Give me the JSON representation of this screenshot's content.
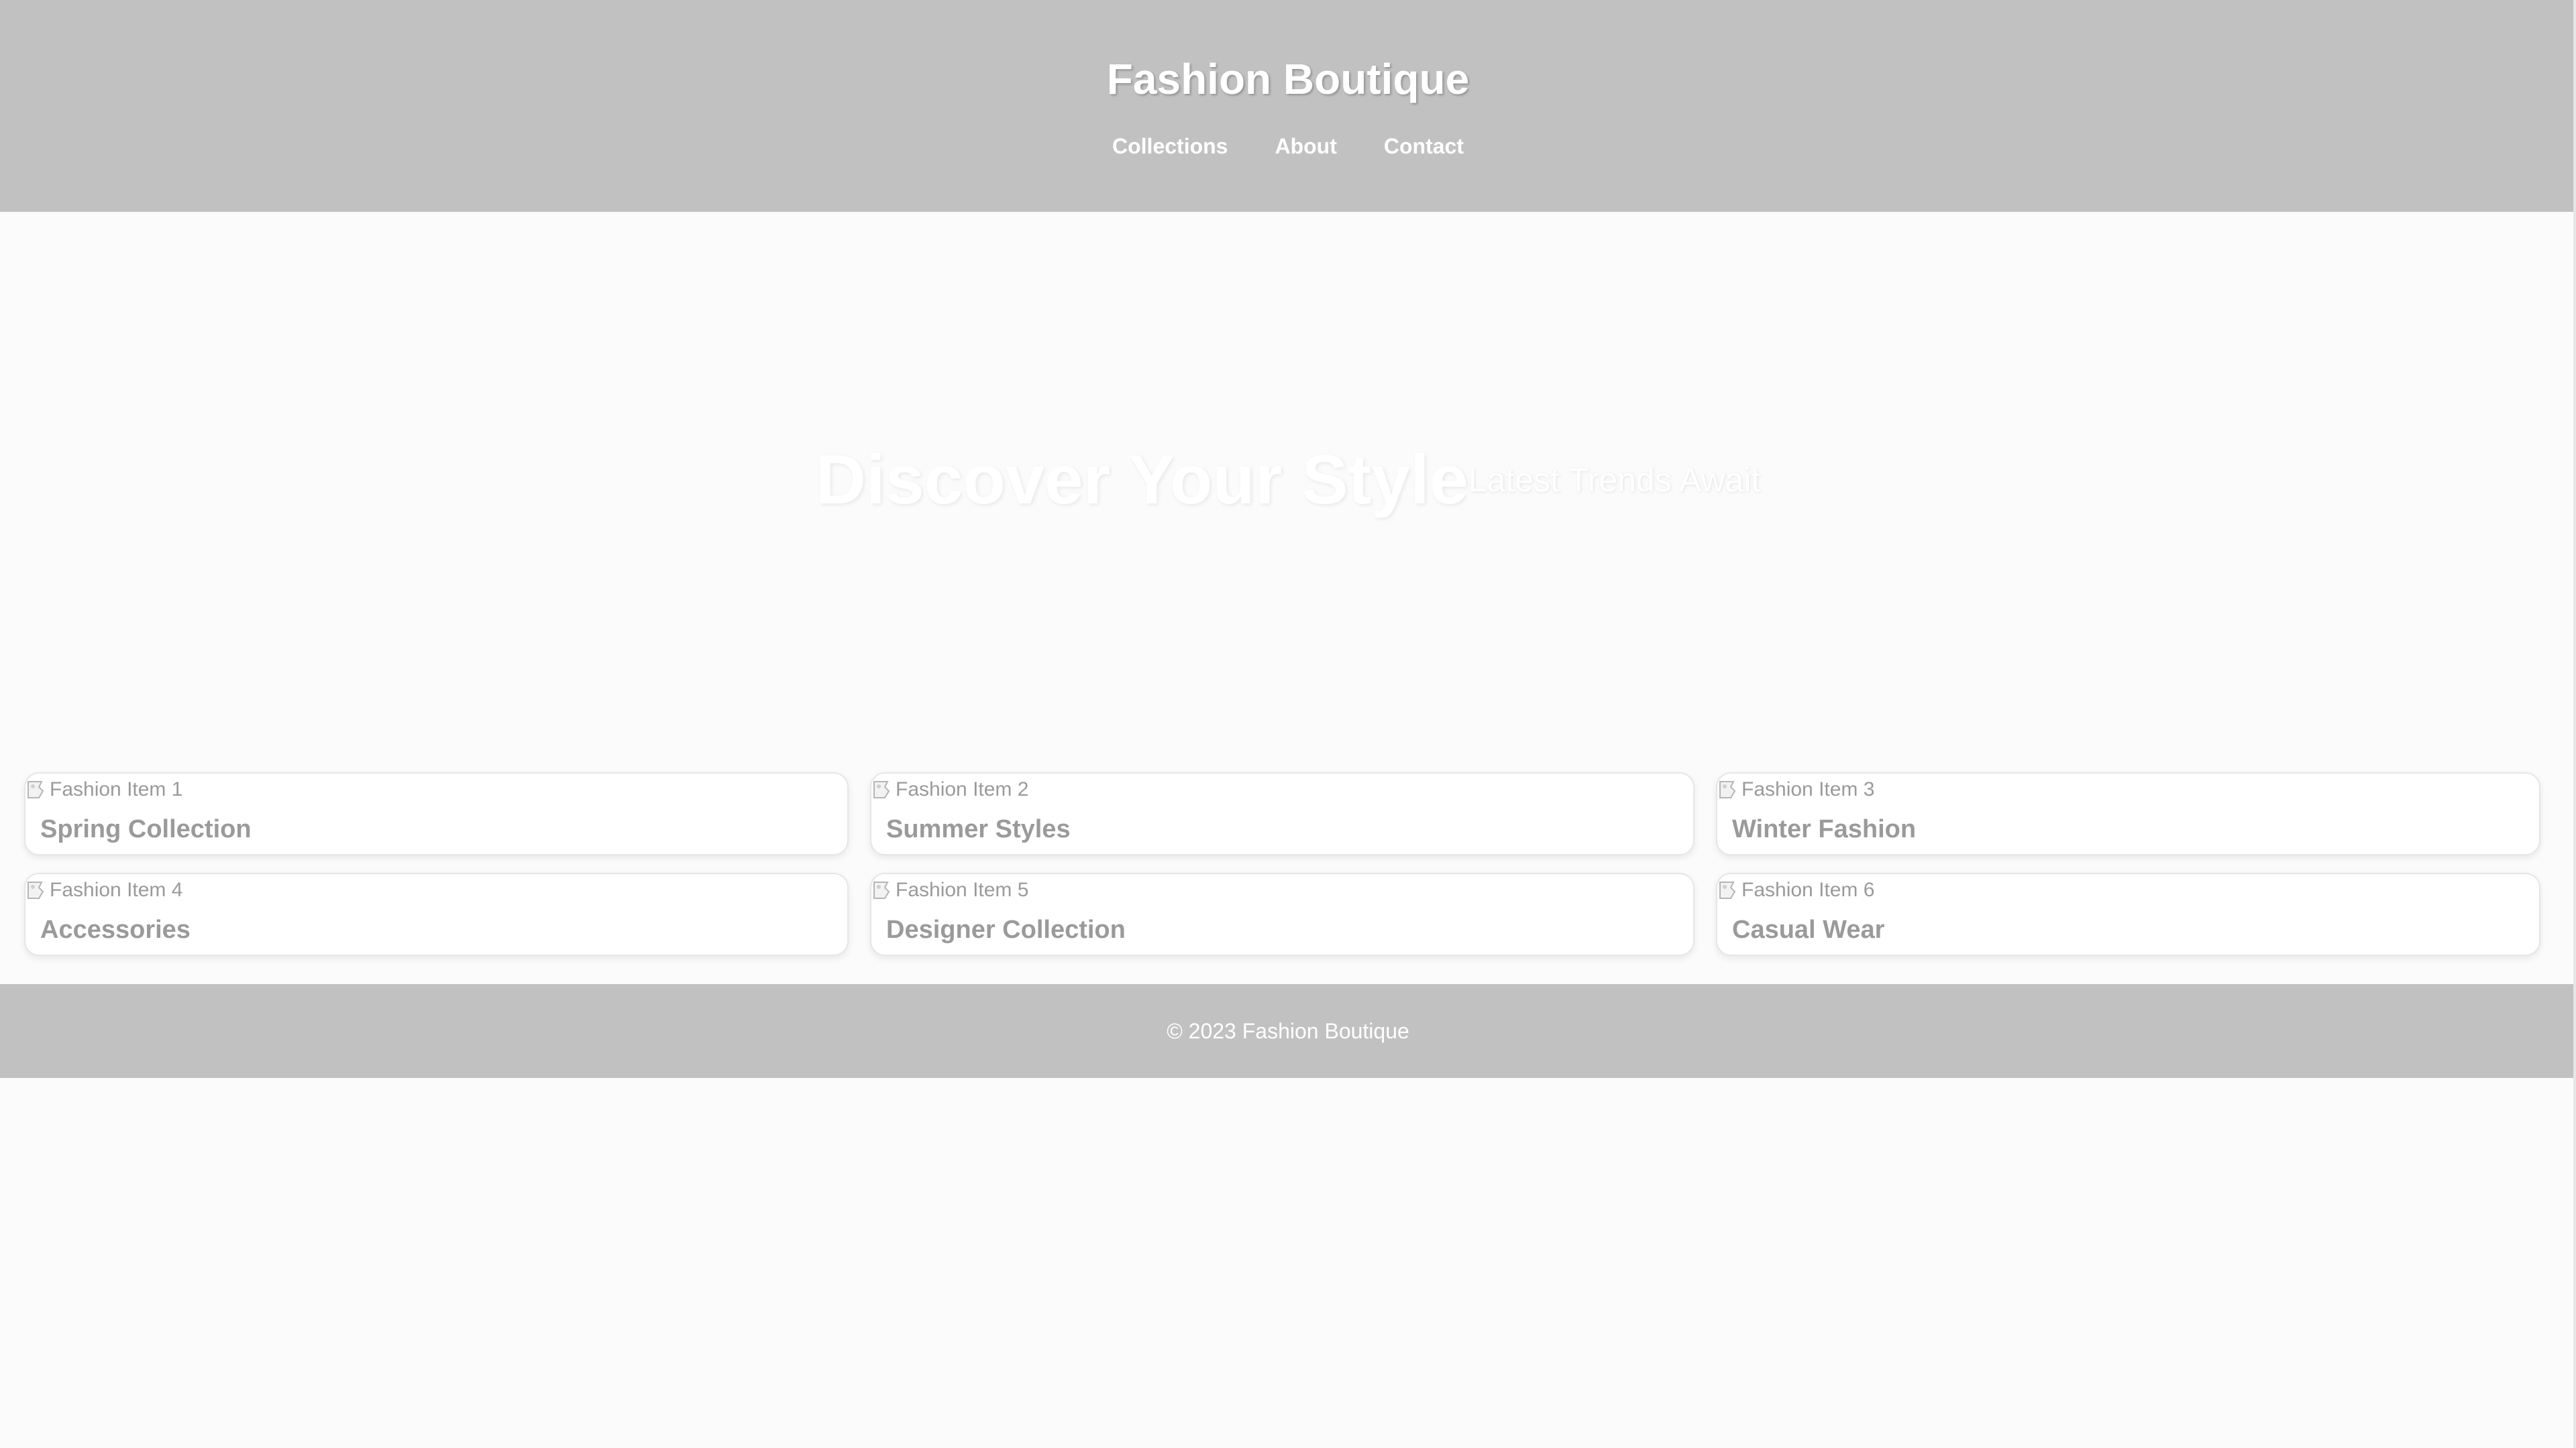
{
  "header": {
    "title": "Fashion Boutique",
    "nav": [
      {
        "label": "Collections"
      },
      {
        "label": "About"
      },
      {
        "label": "Contact"
      }
    ]
  },
  "hero": {
    "title": "Discover Your Style",
    "subtitle": "Latest Trends Await"
  },
  "products": [
    {
      "image_alt": "Fashion Item 1",
      "title": "Spring Collection"
    },
    {
      "image_alt": "Fashion Item 2",
      "title": "Summer Styles"
    },
    {
      "image_alt": "Fashion Item 3",
      "title": "Winter Fashion"
    },
    {
      "image_alt": "Fashion Item 4",
      "title": "Accessories"
    },
    {
      "image_alt": "Fashion Item 5",
      "title": "Designer Collection"
    },
    {
      "image_alt": "Fashion Item 6",
      "title": "Casual Wear"
    }
  ],
  "footer": {
    "text": "© 2023 Fashion Boutique"
  },
  "colors": {
    "header_bg": "#c1c1c1",
    "page_bg": "#fbfbfb",
    "text_light": "#ffffff",
    "text_muted": "#9a9a9a"
  }
}
